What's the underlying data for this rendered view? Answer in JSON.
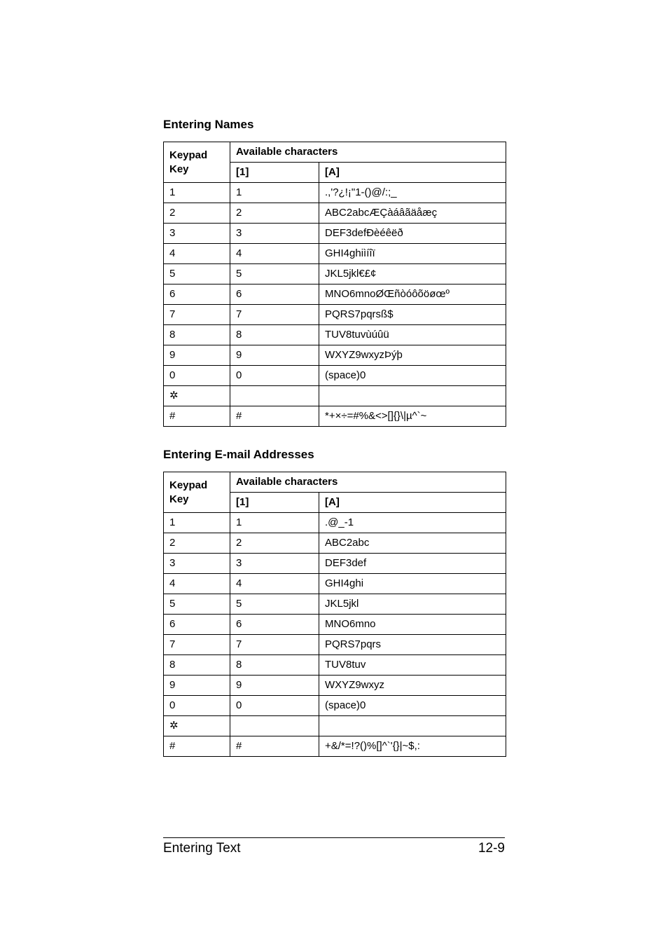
{
  "sections": {
    "names": {
      "heading": "Entering Names",
      "header": {
        "keypad": "Keypad",
        "avail": "Available characters",
        "key": "Key",
        "one": "[1]",
        "a": "[A]"
      },
      "rows": [
        {
          "key": "1",
          "one": "1",
          "a": ".,'?¿!¡\"1-()@/:;_"
        },
        {
          "key": "2",
          "one": "2",
          "a": "ABC2abcÆÇàáâãäåæç"
        },
        {
          "key": "3",
          "one": "3",
          "a": "DEF3defÐèéêëð"
        },
        {
          "key": "4",
          "one": "4",
          "a": "GHI4ghiìíîï"
        },
        {
          "key": "5",
          "one": "5",
          "a": "JKL5jkl€£¢"
        },
        {
          "key": "6",
          "one": "6",
          "a": "MNO6mnoØŒñòóôõöøœº"
        },
        {
          "key": "7",
          "one": "7",
          "a": "PQRS7pqrsß$"
        },
        {
          "key": "8",
          "one": "8",
          "a": "TUV8tuvùúûü"
        },
        {
          "key": "9",
          "one": "9",
          "a": "WXYZ9wxyzÞýþ"
        },
        {
          "key": "0",
          "one": "0",
          "a": "(space)0"
        },
        {
          "key": "✲",
          "one": "",
          "a": ""
        },
        {
          "key": "#",
          "one": "#",
          "a": "*+×÷=#%&<>[]{}\\|µ^`~"
        }
      ]
    },
    "email": {
      "heading": "Entering E-mail Addresses",
      "header": {
        "keypad": "Keypad",
        "avail": "Available characters",
        "key": "Key",
        "one": "[1]",
        "a": "[A]"
      },
      "rows": [
        {
          "key": "1",
          "one": "1",
          "a": ".@_-1"
        },
        {
          "key": "2",
          "one": "2",
          "a": "ABC2abc"
        },
        {
          "key": "3",
          "one": "3",
          "a": "DEF3def"
        },
        {
          "key": "4",
          "one": "4",
          "a": "GHI4ghi"
        },
        {
          "key": "5",
          "one": "5",
          "a": "JKL5jkl"
        },
        {
          "key": "6",
          "one": "6",
          "a": "MNO6mno"
        },
        {
          "key": "7",
          "one": "7",
          "a": "PQRS7pqrs"
        },
        {
          "key": "8",
          "one": "8",
          "a": "TUV8tuv"
        },
        {
          "key": "9",
          "one": "9",
          "a": "WXYZ9wxyz"
        },
        {
          "key": "0",
          "one": "0",
          "a": "(space)0"
        },
        {
          "key": "✲",
          "one": "",
          "a": ""
        },
        {
          "key": "#",
          "one": "#",
          "a": "+&/*=!?()%[]^`'{}|~$,:"
        }
      ]
    }
  },
  "footer": {
    "title": "Entering Text",
    "page": "12-9"
  }
}
